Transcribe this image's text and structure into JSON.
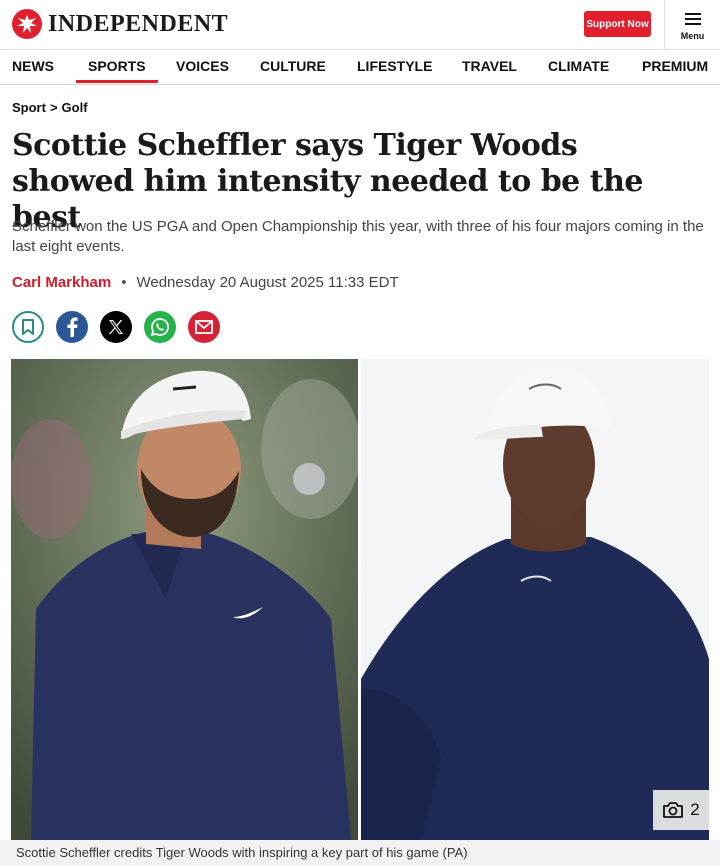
{
  "header": {
    "logo_text": "INDEPENDENT",
    "support_label": "Support Now",
    "menu_label": "Menu"
  },
  "nav": {
    "items": [
      {
        "label": "NEWS",
        "active": false
      },
      {
        "label": "SPORTS",
        "active": true
      },
      {
        "label": "VOICES",
        "active": false
      },
      {
        "label": "CULTURE",
        "active": false
      },
      {
        "label": "LIFESTYLE",
        "active": false
      },
      {
        "label": "TRAVEL",
        "active": false
      },
      {
        "label": "CLIMATE",
        "active": false
      },
      {
        "label": "PREMIUM",
        "active": false
      }
    ]
  },
  "article": {
    "breadcrumb": {
      "section": "Sport",
      "separator": ">",
      "subsection": "Golf"
    },
    "headline": "Scottie Scheffler says Tiger Woods showed him intensity needed to be the best",
    "standfirst": "Scheffler won the US PGA and Open Championship this year, with three of his four majors coming in the last eight events.",
    "author": "Carl Markham",
    "byline_separator": "•",
    "date": "Wednesday 20 August 2025 11:33 EDT",
    "share_icons": [
      "bookmark-icon",
      "facebook-icon",
      "x-icon",
      "whatsapp-icon",
      "email-icon"
    ],
    "gallery_count": "2",
    "caption": "Scottie Scheffler credits Tiger Woods with inspiring a key part of his game (PA)"
  },
  "colors": {
    "brand_red": "#e0202e",
    "author_red": "#d11d2a",
    "facebook": "#2b5797",
    "whatsapp": "#25b24a",
    "email": "#d62235",
    "bookmark": "#2a8a8a"
  }
}
